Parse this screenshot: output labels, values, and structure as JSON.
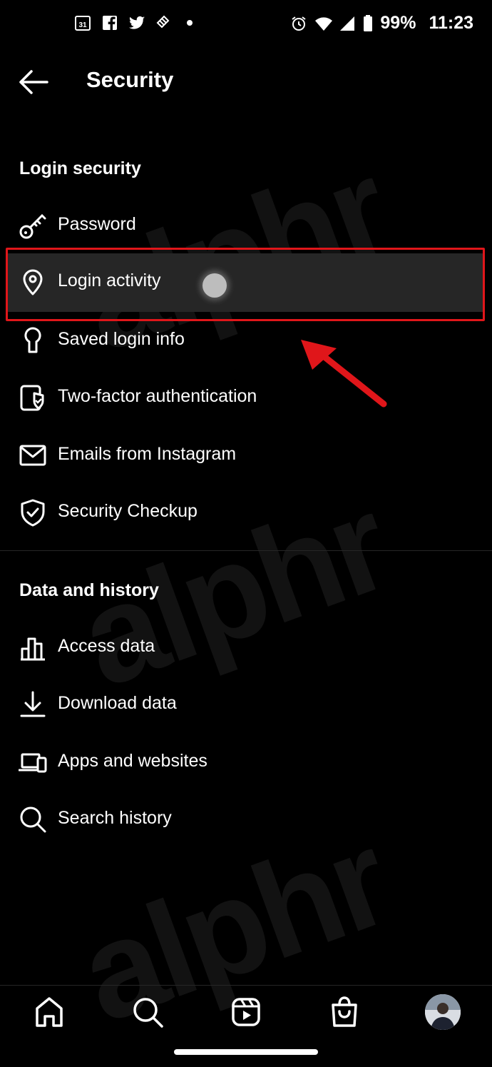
{
  "status_bar": {
    "notification_icons": [
      "calendar-icon",
      "facebook-icon",
      "twitter-icon",
      "pinwheel-app-icon",
      "dot-icon"
    ],
    "calendar_day": "31",
    "battery": "99%",
    "time": "11:23"
  },
  "header": {
    "title": "Security"
  },
  "sections": [
    {
      "title": "Login security",
      "items": [
        {
          "label": "Password",
          "icon": "key-icon"
        },
        {
          "label": "Login activity",
          "icon": "location-pin-icon"
        },
        {
          "label": "Saved login info",
          "icon": "keyhole-icon"
        },
        {
          "label": "Two-factor authentication",
          "icon": "shield-device-icon"
        },
        {
          "label": "Emails from Instagram",
          "icon": "mail-icon"
        },
        {
          "label": "Security Checkup",
          "icon": "shield-check-icon"
        }
      ]
    },
    {
      "title": "Data and history",
      "items": [
        {
          "label": "Access data",
          "icon": "bar-chart-icon"
        },
        {
          "label": "Download data",
          "icon": "download-icon"
        },
        {
          "label": "Apps and websites",
          "icon": "devices-icon"
        },
        {
          "label": "Search history",
          "icon": "search-icon"
        }
      ]
    }
  ],
  "bottom_nav": [
    "home-icon",
    "search-icon",
    "reels-icon",
    "shop-icon",
    "profile-avatar"
  ],
  "watermark": "alphr",
  "colors": {
    "background": "#000000",
    "highlight": "#262626",
    "annotation": "#e0161a"
  }
}
